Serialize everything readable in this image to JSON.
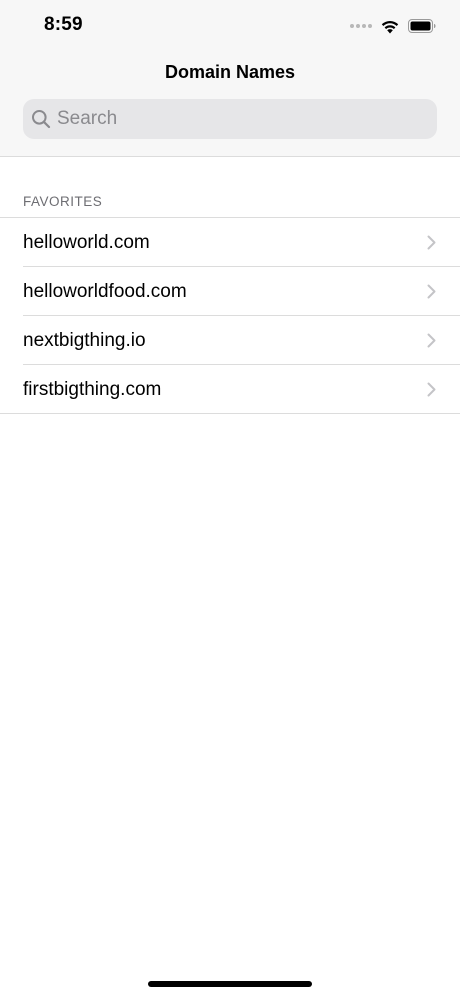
{
  "status_bar": {
    "time": "8:59",
    "icons": [
      "cellular-dots-icon",
      "wifi-icon",
      "battery-icon"
    ]
  },
  "nav": {
    "title": "Domain Names"
  },
  "search": {
    "placeholder": "Search",
    "value": "",
    "icon": "magnifying-glass-icon"
  },
  "section": {
    "header": "FAVORITES",
    "items": [
      {
        "label": "helloworld.com"
      },
      {
        "label": "helloworldfood.com"
      },
      {
        "label": "nextbigthing.io"
      },
      {
        "label": "firstbigthing.com"
      }
    ]
  },
  "colors": {
    "header_bg": "#f7f7f7",
    "search_bg": "#e6e6e8",
    "placeholder": "#8a8a8e",
    "separator": "#dcdcdc",
    "section_header": "#6d6d72",
    "chevron": "#c4c4c7"
  }
}
